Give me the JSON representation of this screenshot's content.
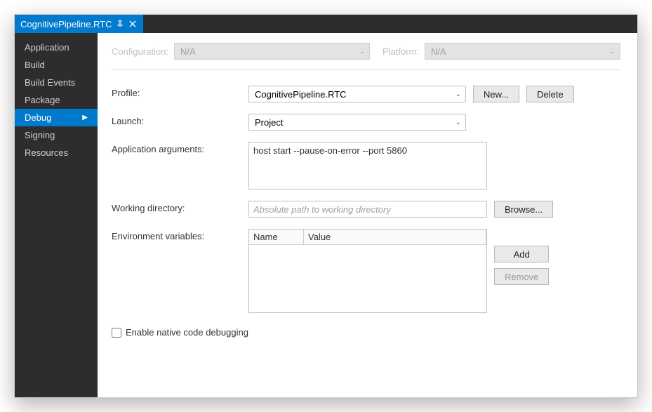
{
  "tab": {
    "title": "CognitivePipeline.RTC"
  },
  "sidebar": {
    "items": [
      {
        "label": "Application",
        "active": false
      },
      {
        "label": "Build",
        "active": false
      },
      {
        "label": "Build Events",
        "active": false
      },
      {
        "label": "Package",
        "active": false
      },
      {
        "label": "Debug",
        "active": true
      },
      {
        "label": "Signing",
        "active": false
      },
      {
        "label": "Resources",
        "active": false
      }
    ]
  },
  "topbar": {
    "configuration_label": "Configuration:",
    "configuration_value": "N/A",
    "platform_label": "Platform:",
    "platform_value": "N/A"
  },
  "form": {
    "profile_label": "Profile:",
    "profile_value": "CognitivePipeline.RTC",
    "new_button": "New...",
    "delete_button": "Delete",
    "launch_label": "Launch:",
    "launch_value": "Project",
    "appargs_label": "Application arguments:",
    "appargs_value": "host start --pause-on-error --port 5860",
    "workingdir_label": "Working directory:",
    "workingdir_placeholder": "Absolute path to working directory",
    "workingdir_value": "",
    "browse_button": "Browse...",
    "envvars_label": "Environment variables:",
    "env_name_header": "Name",
    "env_value_header": "Value",
    "env_rows": [],
    "add_button": "Add",
    "remove_button": "Remove",
    "native_debug_label": "Enable native code debugging",
    "native_debug_checked": false
  }
}
